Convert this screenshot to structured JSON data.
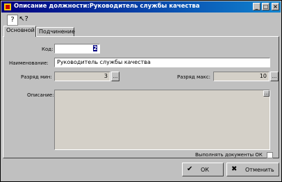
{
  "window": {
    "title": "Описание должности:Руководитель службы качества"
  },
  "titlebar_buttons": [
    "_",
    "□",
    "×"
  ],
  "toolbar": {
    "help_icon": "question-icon",
    "whatsthis_icon": "arrow-help-icon"
  },
  "tabs": [
    {
      "label": "Основной"
    },
    {
      "label": "Подчинение"
    }
  ],
  "form": {
    "code_label": "Код:",
    "code_value": "2",
    "name_label": "Наименование:",
    "name_value": "Руководитель службы качества",
    "rank_min_label": "Разряд мин:",
    "rank_min_value": "3",
    "rank_max_label": "Разряд макс:",
    "rank_max_value": "10",
    "description_label": "Описание:",
    "description_value": "",
    "dots_label": "...",
    "ok_check_label": "Выполнять документы ОК"
  },
  "buttons": {
    "ok": "ОК",
    "cancel": "Отменить"
  }
}
